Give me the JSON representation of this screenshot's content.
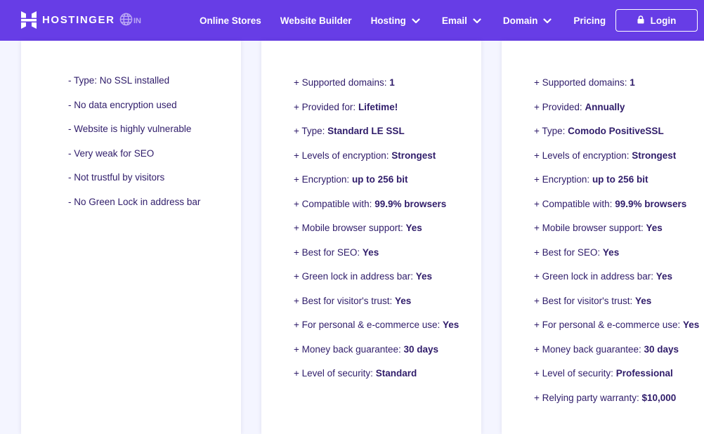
{
  "brand": {
    "name": "HOSTINGER",
    "lang": "IN"
  },
  "nav": {
    "items": [
      {
        "label": "Online Stores",
        "dropdown": false
      },
      {
        "label": "Website Builder",
        "dropdown": false
      },
      {
        "label": "Hosting",
        "dropdown": true
      },
      {
        "label": "Email",
        "dropdown": true
      },
      {
        "label": "Domain",
        "dropdown": true
      },
      {
        "label": "Pricing",
        "dropdown": false
      }
    ],
    "login_label": "Login"
  },
  "colors": {
    "accent": "#673de6",
    "text": "#2f1c6a",
    "background": "#f4f5ff",
    "card": "#ffffff"
  },
  "plans": [
    {
      "features": [
        {
          "prefix": "- ",
          "label": "Type: No SSL installed",
          "value": ""
        },
        {
          "prefix": "- ",
          "label": "No data encryption used",
          "value": ""
        },
        {
          "prefix": "- ",
          "label": "Website is highly vulnerable",
          "value": ""
        },
        {
          "prefix": "- ",
          "label": "Very weak for SEO",
          "value": ""
        },
        {
          "prefix": "- ",
          "label": "Not trustful by visitors",
          "value": ""
        },
        {
          "prefix": "- ",
          "label": "No Green Lock in address bar",
          "value": ""
        }
      ]
    },
    {
      "features": [
        {
          "prefix": "+ ",
          "label": "Supported domains: ",
          "value": "1"
        },
        {
          "prefix": "+ ",
          "label": "Provided for: ",
          "value": "Lifetime!"
        },
        {
          "prefix": "+ ",
          "label": "Type: ",
          "value": "Standard LE SSL"
        },
        {
          "prefix": "+ ",
          "label": "Levels of encryption: ",
          "value": "Strongest"
        },
        {
          "prefix": "+ ",
          "label": "Encryption: ",
          "value": "up to 256 bit"
        },
        {
          "prefix": "+ ",
          "label": "Compatible with: ",
          "value": "99.9% browsers"
        },
        {
          "prefix": "+ ",
          "label": "Mobile browser support: ",
          "value": "Yes"
        },
        {
          "prefix": "+ ",
          "label": "Best for SEO: ",
          "value": "Yes"
        },
        {
          "prefix": "+ ",
          "label": "Green lock in address bar: ",
          "value": "Yes"
        },
        {
          "prefix": "+ ",
          "label": "Best for visitor's trust: ",
          "value": "Yes"
        },
        {
          "prefix": "+ ",
          "label": "For personal & e-commerce use: ",
          "value": "Yes"
        },
        {
          "prefix": "+ ",
          "label": "Money back guarantee: ",
          "value": "30 days"
        },
        {
          "prefix": "+ ",
          "label": "Level of security: ",
          "value": "Standard"
        }
      ]
    },
    {
      "features": [
        {
          "prefix": "+ ",
          "label": "Supported domains: ",
          "value": "1"
        },
        {
          "prefix": "+ ",
          "label": "Provided: ",
          "value": "Annually"
        },
        {
          "prefix": "+ ",
          "label": "Type: ",
          "value": "Comodo PositiveSSL"
        },
        {
          "prefix": "+ ",
          "label": "Levels of encryption: ",
          "value": "Strongest"
        },
        {
          "prefix": "+ ",
          "label": "Encryption: ",
          "value": "up to 256 bit"
        },
        {
          "prefix": "+ ",
          "label": "Compatible with: ",
          "value": "99.9% browsers"
        },
        {
          "prefix": "+ ",
          "label": "Mobile browser support: ",
          "value": "Yes"
        },
        {
          "prefix": "+ ",
          "label": "Best for SEO: ",
          "value": "Yes"
        },
        {
          "prefix": "+ ",
          "label": "Green lock in address bar: ",
          "value": "Yes"
        },
        {
          "prefix": "+ ",
          "label": "Best for visitor's trust: ",
          "value": "Yes"
        },
        {
          "prefix": "+ ",
          "label": "For personal & e-commerce use: ",
          "value": "Yes"
        },
        {
          "prefix": "+ ",
          "label": "Money back guarantee: ",
          "value": "30 days"
        },
        {
          "prefix": "+ ",
          "label": "Level of security: ",
          "value": "Professional"
        },
        {
          "prefix": "+ ",
          "label": "Relying party warranty: ",
          "value": "$10,000"
        }
      ]
    }
  ]
}
